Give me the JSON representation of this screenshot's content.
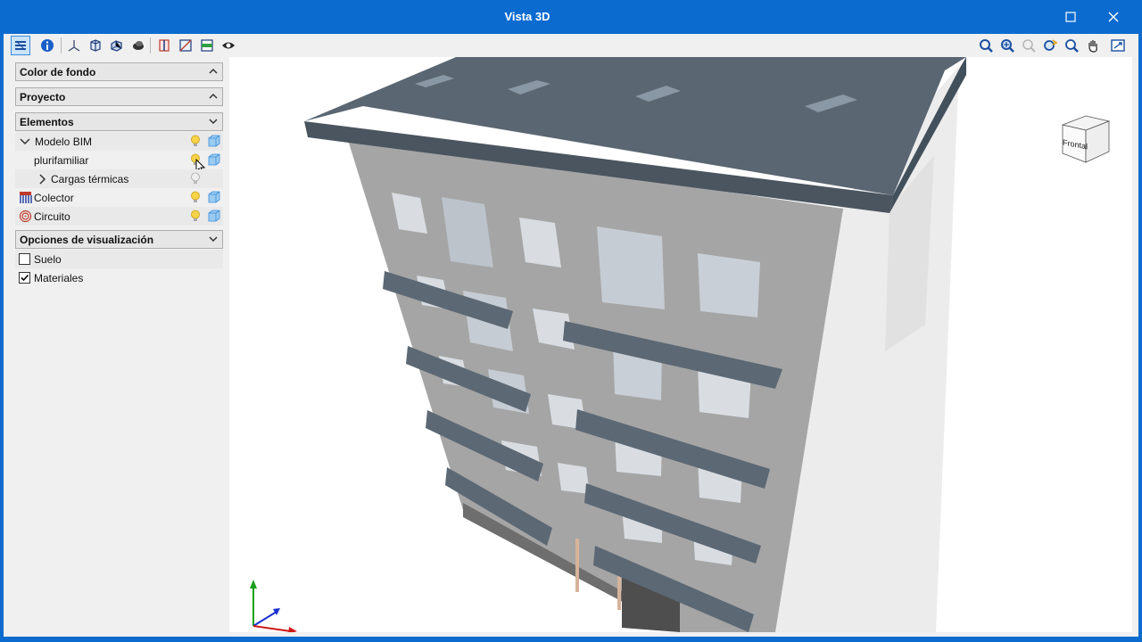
{
  "window": {
    "title": "Vista 3D",
    "maximize_icon": "maximize-icon",
    "close_icon": "close-icon"
  },
  "toolbar": {
    "left_icons": [
      "layers-panel-icon",
      "info-icon",
      "axes-icon",
      "wireframe-icon",
      "solid-view-icon",
      "render-icon",
      "section-cut-icon",
      "clip-box-icon",
      "floor-plan-icon",
      "visibility-icon"
    ],
    "right_icons": [
      "undo-view-icon",
      "zoom-all-icon",
      "zoom-window-icon",
      "orbit-icon",
      "zoom-icon",
      "pan-icon",
      "fit-screen-icon"
    ]
  },
  "panel": {
    "sections": {
      "background_color": "Color de fondo",
      "project": "Proyecto",
      "elements": "Elementos",
      "display_options": "Opciones de visualización"
    },
    "elements": [
      {
        "label": "Modelo BIM"
      },
      {
        "label": "plurifamiliar"
      },
      {
        "label": "Cargas térmicas"
      },
      {
        "label": "Colector"
      },
      {
        "label": "Circuito"
      }
    ],
    "options": [
      {
        "label": "Suelo",
        "checked": false
      },
      {
        "label": "Materiales",
        "checked": true
      }
    ]
  },
  "viewcube": {
    "face_label": "Frontal"
  },
  "colors": {
    "titlebar": "#0b6bcf",
    "roof": "#5a6672",
    "facade": "#a9a9a9",
    "side": "#e8e8e8"
  }
}
